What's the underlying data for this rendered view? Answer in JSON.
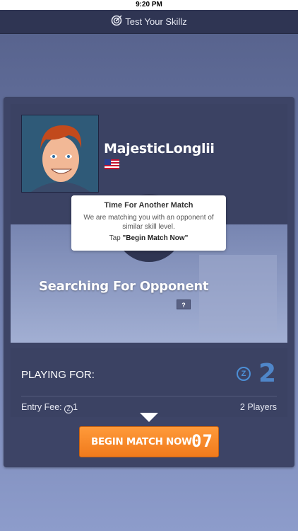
{
  "status_bar": {
    "time": "9:20 PM"
  },
  "nav": {
    "title": "Test Your Skillz",
    "icon": "target-icon"
  },
  "player": {
    "username": "MajesticLonglii",
    "flag": "us-flag-icon"
  },
  "match_tooltip": {
    "title": "Time For Another Match",
    "body": "We are matching you with an opponent of similar skill level.",
    "tap_prefix": "Tap ",
    "tap_action": "\"Begin Match Now\""
  },
  "search": {
    "status": "Searching For Opponent",
    "help_label": "?"
  },
  "prize": {
    "label": "PLAYING FOR:",
    "currency_symbol": "Z",
    "amount": "2",
    "entry_fee_label": "Entry Fee: ",
    "entry_fee_symbol": "Z",
    "entry_fee_value": "1",
    "players": "2 Players"
  },
  "begin_button": {
    "label": "BEGIN MATCH NOW",
    "countdown": "07"
  },
  "colors": {
    "accent_orange": "#f07a1c",
    "prize_blue": "#4f86c9",
    "nav_bg": "#2f3553",
    "card_bg": "#3d4466"
  }
}
